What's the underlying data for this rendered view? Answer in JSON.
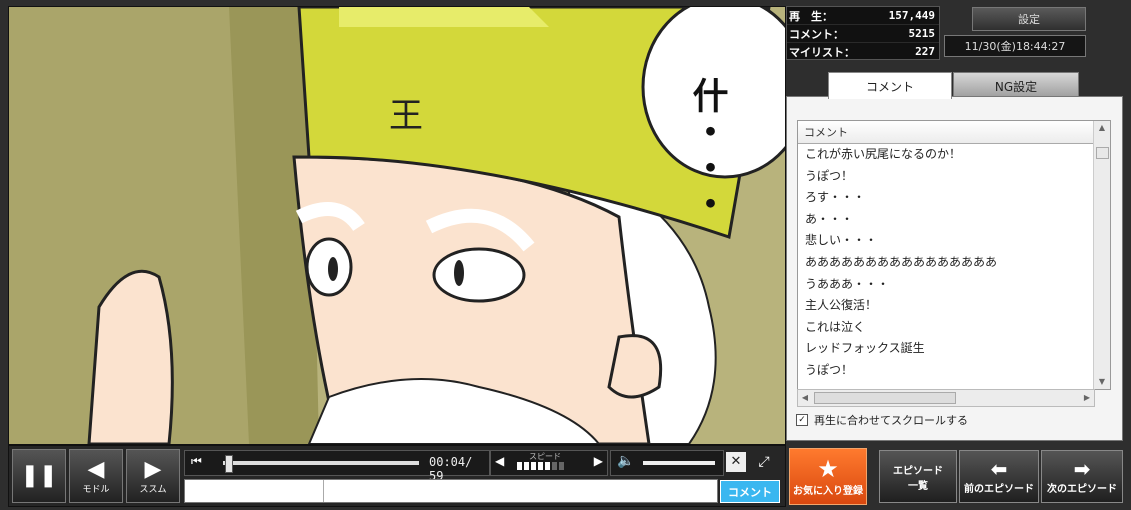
{
  "stats": {
    "plays_label": "再　生：",
    "plays_value": "157,449",
    "comments_label": "コメント：",
    "comments_value": "5215",
    "mylist_label": "マイリスト：",
    "mylist_value": "227"
  },
  "settings_label": "設定",
  "datetime": "11/30(金)18:44:27",
  "tabs": {
    "comment": "コメント",
    "ng": "NG設定"
  },
  "comment_list": {
    "header": "コメント",
    "items": [
      "これが赤い尻尾になるのか！",
      "うぽつ！",
      "ろす・・・",
      "あ・・・",
      "悲しい・・・",
      "ああああああああああああああああ",
      "うあああ・・・",
      "主人公復活！",
      "これは泣く",
      "レッドフォックス誕生",
      "うぽつ！"
    ]
  },
  "autoscroll_label": "再生に合わせてスクロールする",
  "video": {
    "speech_text": "什・・・",
    "crown_glyph": "王"
  },
  "controls": {
    "back_label": "モドル",
    "forward_label": "ススム",
    "time": "00:04/ 59",
    "speed_label": "スピード",
    "speed_level": 5,
    "speed_max": 7,
    "volume_fraction": 0.9,
    "comment_button": "コメント"
  },
  "buttons": {
    "favorite": "お気に入り登録",
    "episode_list_line1": "エピソード",
    "episode_list_line2": "一覧",
    "prev_episode": "前のエピソード",
    "next_episode": "次のエピソード"
  },
  "colors": {
    "accent_orange": "#e8561a",
    "comment_button": "#3ab7f0",
    "crown_yellow": "#d3d83a"
  }
}
